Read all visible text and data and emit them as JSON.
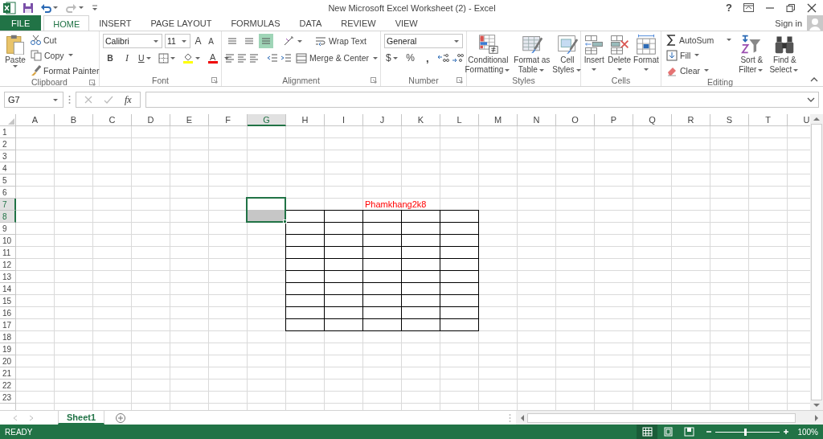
{
  "title_bar": {
    "title": "New Microsoft Excel Worksheet (2) - Excel",
    "help": "?"
  },
  "tabs": [
    {
      "label": "FILE",
      "kind": "file",
      "selected": false
    },
    {
      "label": "HOME",
      "kind": "tab",
      "selected": true
    },
    {
      "label": "INSERT",
      "kind": "tab",
      "selected": false
    },
    {
      "label": "PAGE LAYOUT",
      "kind": "tab",
      "selected": false
    },
    {
      "label": "FORMULAS",
      "kind": "tab",
      "selected": false
    },
    {
      "label": "DATA",
      "kind": "tab",
      "selected": false
    },
    {
      "label": "REVIEW",
      "kind": "tab",
      "selected": false
    },
    {
      "label": "VIEW",
      "kind": "tab",
      "selected": false
    }
  ],
  "account": {
    "sign_in": "Sign in"
  },
  "ribbon": {
    "clipboard": {
      "label": "Clipboard",
      "paste": "Paste",
      "cut": "Cut",
      "copy": "Copy",
      "format_painter": "Format Painter"
    },
    "font": {
      "label": "Font",
      "name": "Calibri",
      "size": "11",
      "grow": "A",
      "shrink": "A",
      "bold": "B",
      "italic": "I",
      "underline": "U",
      "color_letter": "A"
    },
    "alignment": {
      "label": "Alignment",
      "wrap_text": "Wrap Text",
      "merge_center": "Merge & Center",
      "vertical_align": [
        {
          "selected": false
        },
        {
          "selected": false
        },
        {
          "selected": true
        }
      ]
    },
    "number": {
      "label": "Number",
      "format": "General",
      "currency": "$",
      "percent": "%",
      "comma": ","
    },
    "styles": {
      "label": "Styles",
      "buttons": [
        {
          "kind": "conditional",
          "lines": [
            "Conditional",
            "Formatting"
          ]
        },
        {
          "kind": "table",
          "lines": [
            "Format as",
            "Table"
          ]
        },
        {
          "kind": "cellstyles",
          "lines": [
            "Cell",
            "Styles"
          ]
        }
      ]
    },
    "cells": {
      "label": "Cells",
      "buttons": [
        {
          "kind": "insert",
          "lines": [
            "Insert"
          ]
        },
        {
          "kind": "delete",
          "lines": [
            "Delete"
          ]
        },
        {
          "kind": "format",
          "lines": [
            "Format"
          ]
        }
      ]
    },
    "editing": {
      "label": "Editing",
      "autosum": "AutoSum",
      "fill": "Fill",
      "clear": "Clear",
      "buttons": [
        {
          "kind": "sort",
          "lines": [
            "Sort &",
            "Filter"
          ]
        },
        {
          "kind": "find",
          "lines": [
            "Find &",
            "Select"
          ]
        }
      ]
    }
  },
  "formula_bar": {
    "name_box": "G7",
    "fx": "fx"
  },
  "sheet": {
    "columns": [
      {
        "label": "A",
        "selected": false
      },
      {
        "label": "B",
        "selected": false
      },
      {
        "label": "C",
        "selected": false
      },
      {
        "label": "D",
        "selected": false
      },
      {
        "label": "E",
        "selected": false
      },
      {
        "label": "F",
        "selected": false
      },
      {
        "label": "G",
        "selected": true
      },
      {
        "label": "H",
        "selected": false
      },
      {
        "label": "I",
        "selected": false
      },
      {
        "label": "J",
        "selected": false
      },
      {
        "label": "K",
        "selected": false
      },
      {
        "label": "L",
        "selected": false
      },
      {
        "label": "M",
        "selected": false
      },
      {
        "label": "N",
        "selected": false
      },
      {
        "label": "O",
        "selected": false
      },
      {
        "label": "P",
        "selected": false
      },
      {
        "label": "Q",
        "selected": false
      },
      {
        "label": "R",
        "selected": false
      },
      {
        "label": "S",
        "selected": false
      },
      {
        "label": "T",
        "selected": false
      },
      {
        "label": "U",
        "selected": false
      }
    ],
    "rows": [
      {
        "label": "1",
        "selected": false
      },
      {
        "label": "2",
        "selected": false
      },
      {
        "label": "3",
        "selected": false
      },
      {
        "label": "4",
        "selected": false
      },
      {
        "label": "5",
        "selected": false
      },
      {
        "label": "6",
        "selected": false
      },
      {
        "label": "7",
        "selected": true
      },
      {
        "label": "8",
        "selected": true
      },
      {
        "label": "9",
        "selected": false
      },
      {
        "label": "10",
        "selected": false
      },
      {
        "label": "11",
        "selected": false
      },
      {
        "label": "12",
        "selected": false
      },
      {
        "label": "13",
        "selected": false
      },
      {
        "label": "14",
        "selected": false
      },
      {
        "label": "15",
        "selected": false
      },
      {
        "label": "16",
        "selected": false
      },
      {
        "label": "17",
        "selected": false
      },
      {
        "label": "18",
        "selected": false
      },
      {
        "label": "19",
        "selected": false
      },
      {
        "label": "20",
        "selected": false
      },
      {
        "label": "21",
        "selected": false
      },
      {
        "label": "22",
        "selected": false
      },
      {
        "label": "23",
        "selected": false
      }
    ],
    "table": {
      "title": "Phamkhang2k8"
    }
  },
  "sheet_tabs": [
    {
      "label": "Sheet1",
      "selected": true
    }
  ],
  "status_bar": {
    "mode": "READY",
    "views": [
      {
        "kind": "normal",
        "selected": true
      },
      {
        "kind": "page_layout",
        "selected": false
      },
      {
        "kind": "page_break",
        "selected": false
      }
    ],
    "zoom_slider": {
      "level": 0.46
    },
    "zoom": "100%"
  }
}
